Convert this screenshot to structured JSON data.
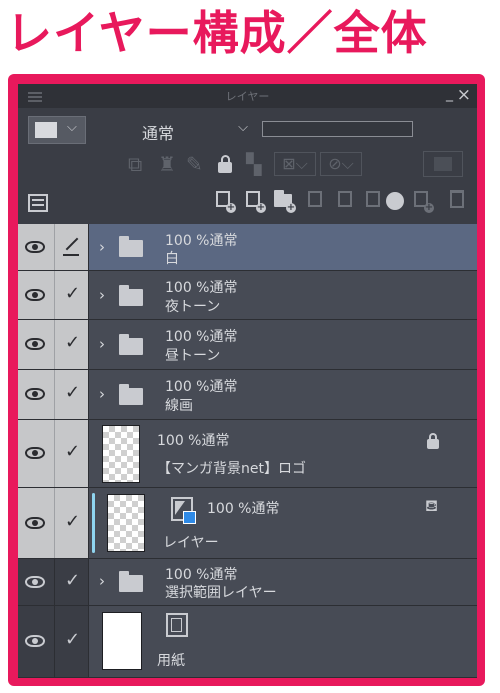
{
  "page_title": "レイヤー構成／全体",
  "panel": {
    "title": "レイヤー",
    "minimize": "_",
    "close": "×"
  },
  "toolbar": {
    "blend_mode": "通常",
    "opacity_value": "",
    "row2_icons": [
      "clip-to-layer-below-icon",
      "reference-layer-icon",
      "draft-layer-icon",
      "lock-icon",
      "lock-transparent-icon",
      "mask-enable-icon",
      "mask-range-icon",
      "layer-palette-icon"
    ],
    "row3_icons": [
      "layer-property-icon",
      "new-raster-layer-icon",
      "new-vector-layer-icon",
      "new-folder-icon",
      "transfer-down-icon",
      "combine-down-icon",
      "create-mask-icon",
      "apply-mask-icon",
      "delete-layer-icon"
    ]
  },
  "layers": [
    {
      "opacity_blend": "100 %通常",
      "name": "白",
      "type": "folder",
      "selected": true,
      "editing": true
    },
    {
      "opacity_blend": "100 %通常",
      "name": "夜トーン",
      "type": "folder"
    },
    {
      "opacity_blend": "100 %通常",
      "name": "昼トーン",
      "type": "folder"
    },
    {
      "opacity_blend": "100 %通常",
      "name": "線画",
      "type": "folder"
    },
    {
      "opacity_blend": "100 %通常",
      "name": "【マンガ背景net】ロゴ",
      "type": "raster",
      "locked": true
    },
    {
      "opacity_blend": "100 %通常",
      "name": "レイヤー",
      "type": "raster-mask",
      "reference": true
    },
    {
      "opacity_blend": "100 %通常",
      "name": "選択範囲レイヤー",
      "type": "folder"
    },
    {
      "opacity_blend": "",
      "name": "用紙",
      "type": "paper"
    }
  ],
  "colors": {
    "accent": "#e8195c",
    "panel_bg": "#3a3d45",
    "row_bg": "#474b55",
    "selected_row": "#5b6882",
    "selection_bar": "#8fd4ef"
  }
}
